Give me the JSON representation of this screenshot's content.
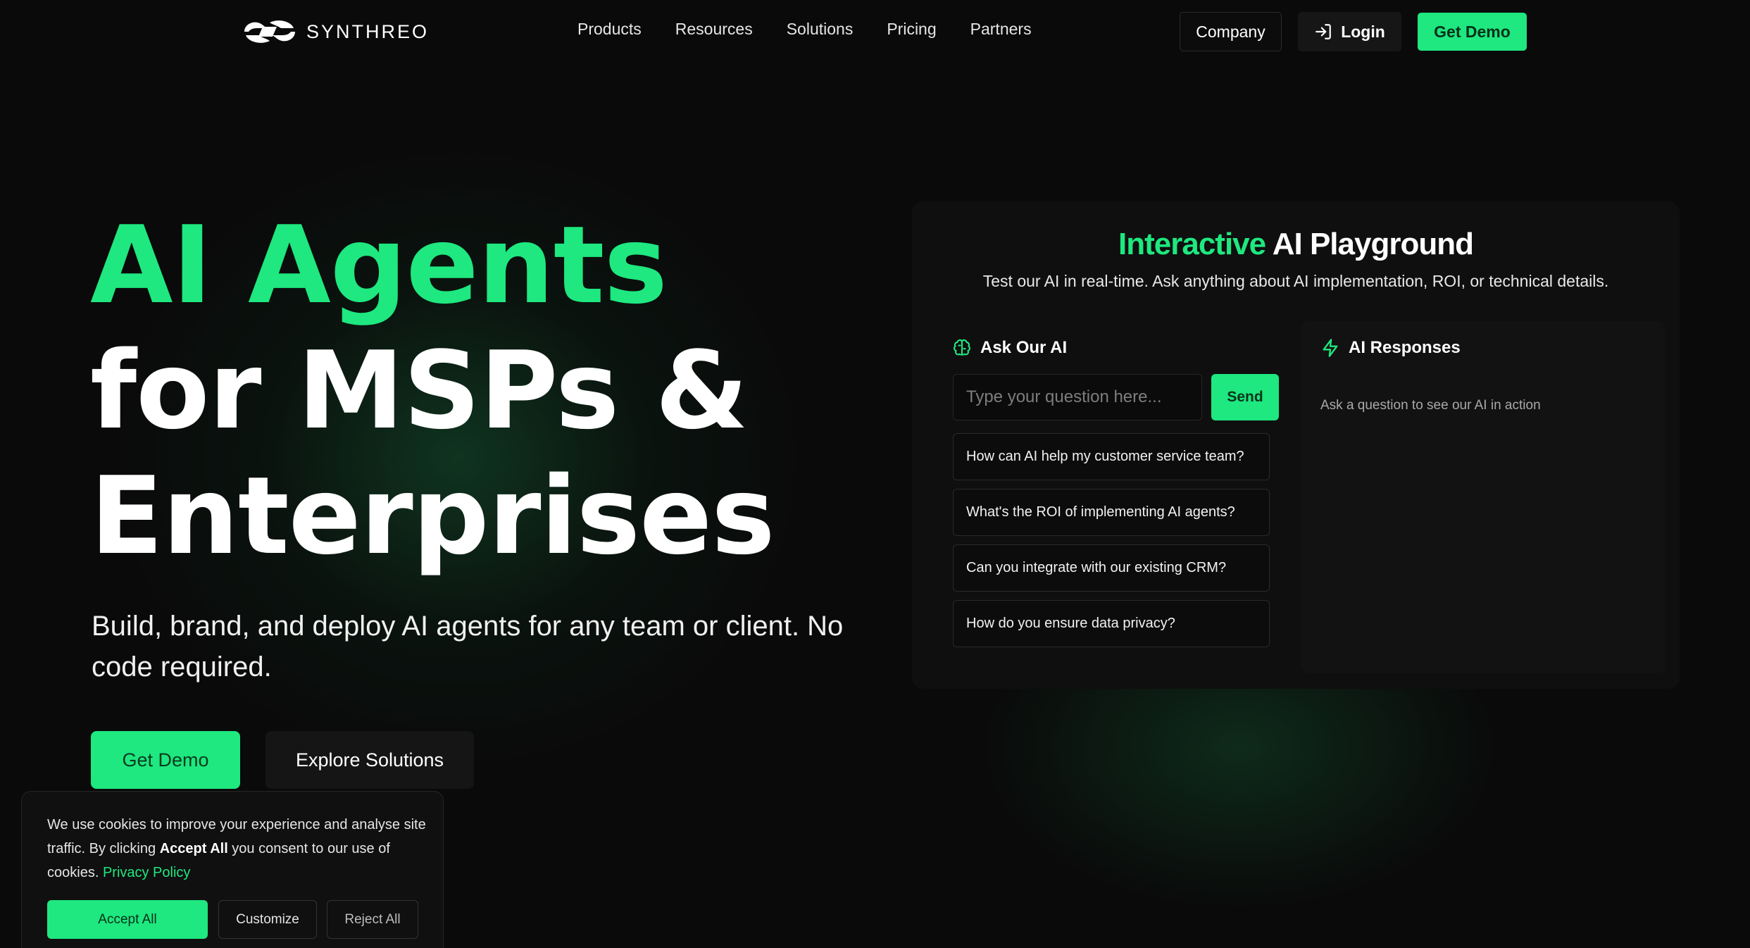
{
  "nav": {
    "brand": "SYNTHREO",
    "links": [
      "Products",
      "Resources",
      "Solutions",
      "Pricing",
      "Partners"
    ],
    "company_label": "Company",
    "login_label": "Login",
    "demo_label": "Get Demo"
  },
  "hero": {
    "title_line1": "AI Agents",
    "title_line2": "for MSPs &",
    "title_line3": "Enterprises",
    "subtitle": "Build, brand, and deploy AI agents for any team or client. No code required.",
    "demo_label": "Get Demo",
    "explore_label": "Explore Solutions"
  },
  "playground": {
    "title_accent": "Interactive",
    "title_rest": "AI Playground",
    "description": "Test our AI in real-time. Ask anything about AI implementation, ROI, or technical details.",
    "ask_heading": "Ask Our AI",
    "input_placeholder": "Type your question here...",
    "send_label": "Send",
    "suggestions": [
      "How can AI help my customer service team?",
      "What's the ROI of implementing AI agents?",
      "Can you integrate with our existing CRM?",
      "How do you ensure data privacy?"
    ],
    "responses_heading": "AI Responses",
    "responses_empty": "Ask a question to see our AI in action"
  },
  "cookie": {
    "text_pre": "We use cookies to improve your experience and analyse site traffic. By clicking ",
    "text_bold": "Accept All",
    "text_post": " you consent to our use of cookies. ",
    "policy_link": "Privacy Policy",
    "accept_label": "Accept All",
    "customize_label": "Customize",
    "reject_label": "Reject All"
  },
  "colors": {
    "accent": "#1ee87f",
    "background": "#0a0a0a",
    "panel": "#0f0f0f"
  },
  "icons": [
    "synthreo-logo-icon",
    "login-icon",
    "brain-icon",
    "lightning-icon"
  ]
}
